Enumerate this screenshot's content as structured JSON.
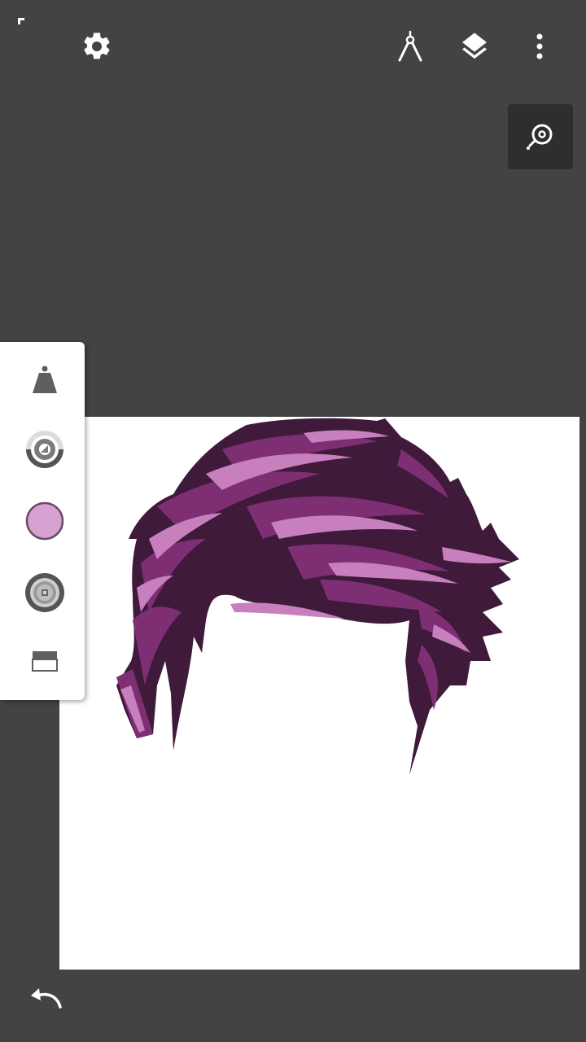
{
  "icons": {
    "fullscreen": "fullscreen-corner-icon",
    "settings": "gear-icon",
    "ruler": "compass-ruler-icon",
    "layers": "layers-icon",
    "more": "more-vertical-icon",
    "zoom": "zoom-magnifier-icon",
    "brush": "brush-type-icon",
    "opacity": "opacity-dial-icon",
    "color": "color-swatch-icon",
    "size": "brush-size-dial-icon",
    "eraser": "eraser-icon",
    "undo": "undo-icon"
  },
  "colors": {
    "background": "#434343",
    "canvas": "#ffffff",
    "toolbox": "#ffffff",
    "zoom_button_bg": "#2e2e2e",
    "current_color": "#d7a2d2",
    "hair_dark": "#3f1a3a",
    "hair_mid": "#7e2f74",
    "hair_light": "#c77fbd"
  }
}
